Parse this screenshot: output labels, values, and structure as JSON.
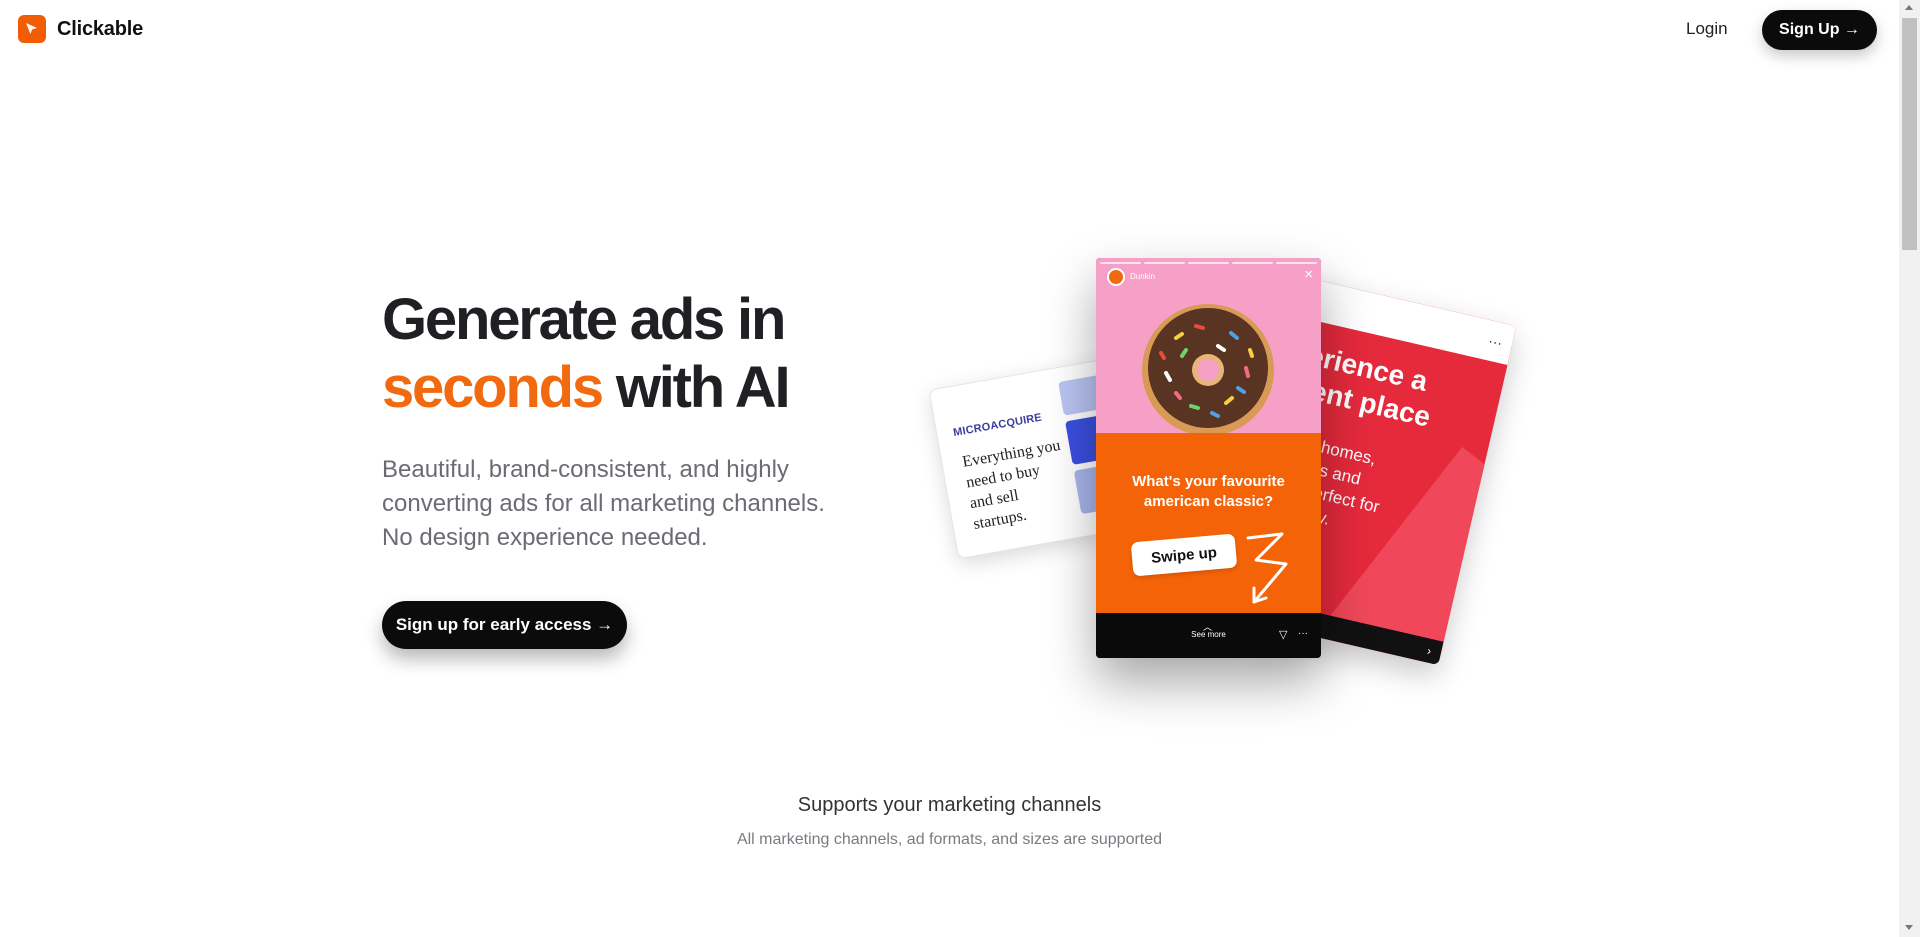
{
  "header": {
    "brand": "Clickable",
    "login_label": "Login",
    "signup_label": "Sign Up →"
  },
  "hero": {
    "title_line1": "Generate ads in",
    "title_accent": "seconds",
    "title_rest": " with AI",
    "subtitle_line1": "Beautiful, brand-consistent, and highly",
    "subtitle_line2": "converting ads for all marketing channels.",
    "subtitle_line3": "No design experience needed.",
    "cta_label": "Sign up for early access →"
  },
  "showcase": {
    "left_card": {
      "brand": "MICROACQUIRE",
      "copy": "Everything you need to buy and sell startups."
    },
    "phone": {
      "account": "Dunkin",
      "question": "What's your favourite american classic?",
      "swipe_label": "Swipe up",
      "see_more": "See more",
      "close_icon": "×"
    },
    "right_card": {
      "headline_line1": "erience a",
      "headline_line2": "rent place",
      "body_line1": "que homes,",
      "body_line2": "entals and",
      "body_line3": "ins perfect for",
      "body_line4": "etaway.",
      "pill": "→",
      "dots": "···",
      "chevron": "›"
    }
  },
  "supports": {
    "title": "Supports your marketing channels",
    "subtitle": "All marketing channels, ad formats, and sizes are supported"
  },
  "colors": {
    "accent": "#f26a0f",
    "dark": "#0b0b0b",
    "pink": "#f6a0c8",
    "orange": "#f46308",
    "red": "#e52a3c"
  }
}
